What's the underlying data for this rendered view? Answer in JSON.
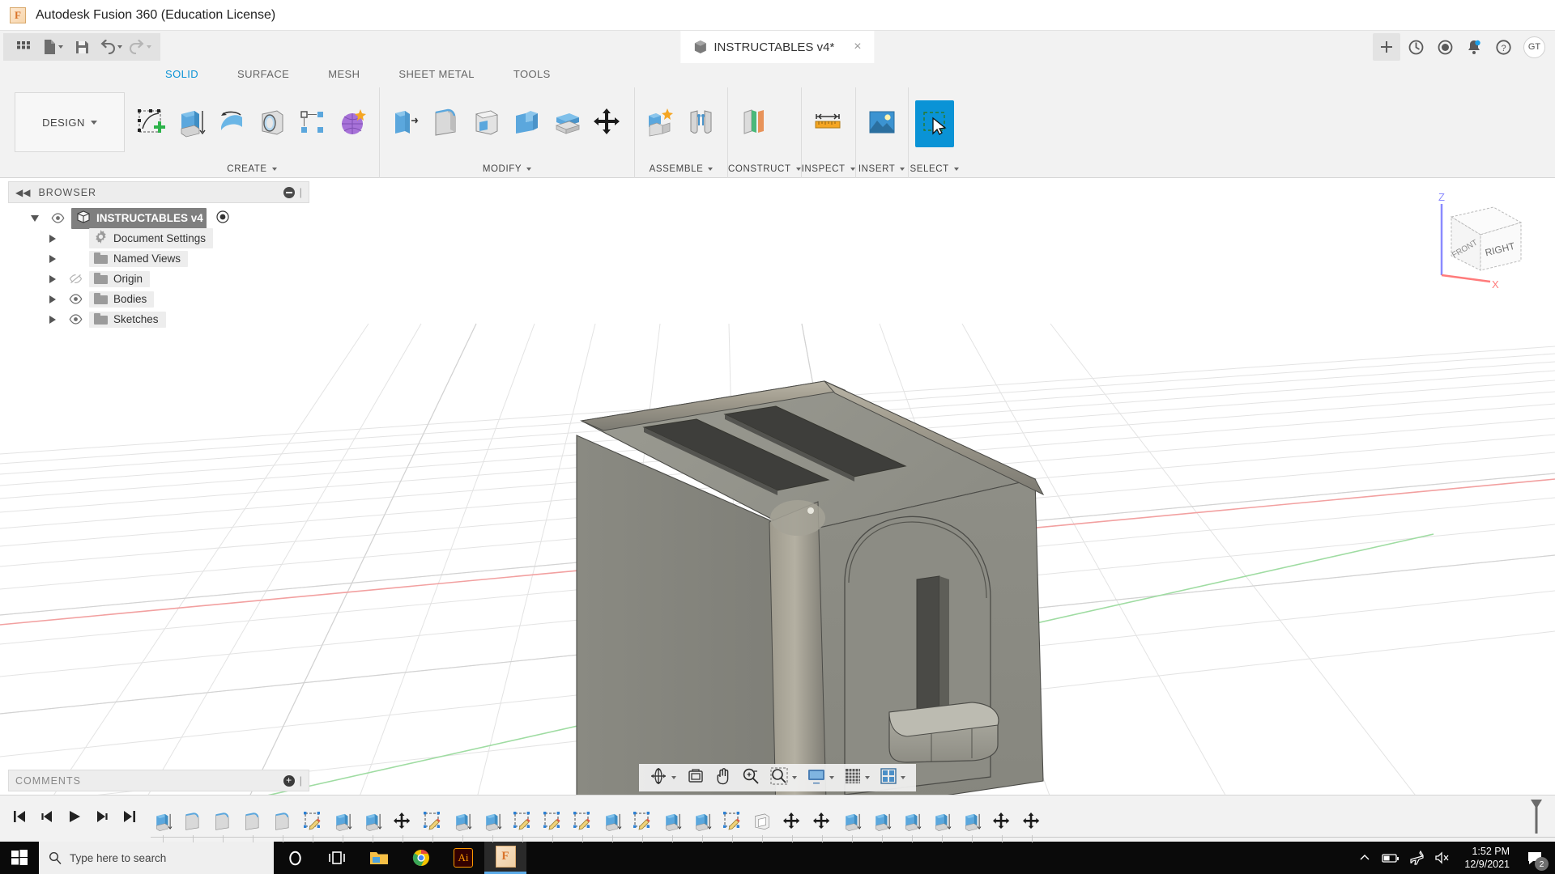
{
  "window": {
    "app_title": "Autodesk Fusion 360 (Education License)",
    "app_icon": "fusion-logo-icon"
  },
  "quick_access": {
    "grid_label": "app-grid",
    "items": [
      {
        "name": "new-document",
        "icon": "file-icon",
        "caret": true
      },
      {
        "name": "save",
        "icon": "save-icon",
        "caret": false
      },
      {
        "name": "undo",
        "icon": "undo-arrow-icon",
        "caret": true
      },
      {
        "name": "redo",
        "icon": "redo-arrow-icon",
        "caret": true
      }
    ]
  },
  "document_tab": {
    "title": "INSTRUCTABLES v4*",
    "icon": "document-cube-icon",
    "close_label": "×",
    "add_label": "+"
  },
  "top_right_icons": [
    {
      "name": "add-tab-button",
      "glyph": "+"
    },
    {
      "name": "job-status-icon",
      "glyph": "circle-arrow"
    },
    {
      "name": "history-clock-icon",
      "glyph": "clock"
    },
    {
      "name": "notifications-bell-icon",
      "glyph": "bell"
    },
    {
      "name": "help-question-icon",
      "glyph": "question"
    }
  ],
  "account": {
    "initials": "GT"
  },
  "ribbon": {
    "workspace_label": "DESIGN",
    "tabs": [
      {
        "label": "SOLID",
        "active": true
      },
      {
        "label": "SURFACE",
        "active": false
      },
      {
        "label": "MESH",
        "active": false
      },
      {
        "label": "SHEET METAL",
        "active": false
      },
      {
        "label": "TOOLS",
        "active": false
      }
    ],
    "groups": [
      {
        "label": "CREATE",
        "has_caret": true,
        "items": [
          {
            "name": "create-sketch-button",
            "icon": "sketch-plus-icon"
          },
          {
            "name": "extrude-button",
            "icon": "extrude-icon"
          },
          {
            "name": "revolve-button",
            "icon": "revolve-icon"
          },
          {
            "name": "hole-button",
            "icon": "hole-icon"
          },
          {
            "name": "pattern-button",
            "icon": "rectangular-pattern-icon"
          },
          {
            "name": "form-button",
            "icon": "form-sculpt-icon"
          }
        ]
      },
      {
        "label": "MODIFY",
        "has_caret": true,
        "items": [
          {
            "name": "press-pull-button",
            "icon": "press-pull-icon"
          },
          {
            "name": "fillet-button",
            "icon": "fillet-icon"
          },
          {
            "name": "shell-button",
            "icon": "shell-icon"
          },
          {
            "name": "combine-button",
            "icon": "combine-icon"
          },
          {
            "name": "offset-face-button",
            "icon": "offset-face-icon"
          },
          {
            "name": "move-copy-button",
            "icon": "move-copy-icon"
          }
        ]
      },
      {
        "label": "ASSEMBLE",
        "has_caret": true,
        "items": [
          {
            "name": "new-component-button",
            "icon": "new-component-icon"
          },
          {
            "name": "joint-button",
            "icon": "joint-icon"
          }
        ]
      },
      {
        "label": "CONSTRUCT",
        "has_caret": true,
        "items": [
          {
            "name": "offset-plane-button",
            "icon": "construction-plane-icon"
          }
        ]
      },
      {
        "label": "INSPECT",
        "has_caret": true,
        "items": [
          {
            "name": "measure-button",
            "icon": "measure-ruler-icon"
          }
        ]
      },
      {
        "label": "INSERT",
        "has_caret": true,
        "items": [
          {
            "name": "insert-canvas-button",
            "icon": "image-canvas-icon"
          }
        ]
      },
      {
        "label": "SELECT",
        "has_caret": true,
        "items": [
          {
            "name": "select-tool-button",
            "icon": "select-cursor-icon",
            "selected": true
          }
        ]
      }
    ]
  },
  "browser": {
    "panel_title": "BROWSER",
    "collapse_icon": "double-chevron-left-icon",
    "tree": [
      {
        "label": "INSTRUCTABLES v4",
        "icon": "component-cube-icon",
        "indent": 0,
        "expanded": true,
        "visible": true,
        "selected": true,
        "has_radio": true
      },
      {
        "label": "Document Settings",
        "icon": "gear-icon",
        "indent": 1,
        "expanded": false,
        "visible": null,
        "selected": false
      },
      {
        "label": "Named Views",
        "icon": "folder-icon",
        "indent": 1,
        "expanded": false,
        "visible": null,
        "selected": false
      },
      {
        "label": "Origin",
        "icon": "folder-icon",
        "indent": 1,
        "expanded": false,
        "visible": false,
        "selected": false
      },
      {
        "label": "Bodies",
        "icon": "folder-icon",
        "indent": 1,
        "expanded": false,
        "visible": true,
        "selected": false
      },
      {
        "label": "Sketches",
        "icon": "folder-icon",
        "indent": 1,
        "expanded": false,
        "visible": true,
        "selected": false
      }
    ]
  },
  "comments": {
    "title": "COMMENTS",
    "add_icon": "plus-circle-icon"
  },
  "viewcube": {
    "front_face": "FRONT",
    "right_face": "RIGHT",
    "axis_z": "Z",
    "axis_x": "X",
    "axis_z_color": "#6a6aff",
    "axis_x_color": "#ff5a5a"
  },
  "navbar": {
    "items": [
      {
        "name": "orbit-button",
        "icon": "orbit-icon",
        "caret": true
      },
      {
        "name": "look-at-button",
        "icon": "look-at-icon",
        "caret": false
      },
      {
        "name": "pan-button",
        "icon": "pan-hand-icon",
        "caret": false
      },
      {
        "name": "zoom-button",
        "icon": "zoom-magnifier-icon",
        "caret": false
      },
      {
        "name": "fit-button",
        "icon": "fit-window-icon",
        "caret": true
      },
      {
        "name": "display-settings-button",
        "icon": "monitor-display-icon",
        "caret": true
      },
      {
        "name": "grid-snaps-button",
        "icon": "grid-icon",
        "caret": true
      },
      {
        "name": "viewports-button",
        "icon": "viewports-icon",
        "caret": true
      }
    ]
  },
  "timeline": {
    "playback": [
      {
        "name": "go-to-beginning-button",
        "icon": "skip-start-icon"
      },
      {
        "name": "step-back-button",
        "icon": "step-back-icon"
      },
      {
        "name": "play-button",
        "icon": "play-icon"
      },
      {
        "name": "step-forward-button",
        "icon": "step-forward-icon"
      },
      {
        "name": "go-to-end-button",
        "icon": "skip-end-icon"
      }
    ],
    "features": [
      {
        "name": "timeline-feature-extrude",
        "icon": "extrude-icon"
      },
      {
        "name": "timeline-feature-fillet",
        "icon": "fillet-icon"
      },
      {
        "name": "timeline-feature-fillet",
        "icon": "fillet-icon"
      },
      {
        "name": "timeline-feature-fillet",
        "icon": "fillet-icon"
      },
      {
        "name": "timeline-feature-fillet",
        "icon": "fillet-icon"
      },
      {
        "name": "timeline-feature-sketch",
        "icon": "sketch-icon"
      },
      {
        "name": "timeline-feature-extrude",
        "icon": "extrude-icon"
      },
      {
        "name": "timeline-feature-extrude",
        "icon": "extrude-icon"
      },
      {
        "name": "timeline-feature-move",
        "icon": "move-icon"
      },
      {
        "name": "timeline-feature-sketch",
        "icon": "sketch-icon"
      },
      {
        "name": "timeline-feature-extrude",
        "icon": "extrude-icon"
      },
      {
        "name": "timeline-feature-extrude",
        "icon": "extrude-icon"
      },
      {
        "name": "timeline-feature-sketch",
        "icon": "sketch-icon"
      },
      {
        "name": "timeline-feature-sketch",
        "icon": "sketch-icon"
      },
      {
        "name": "timeline-feature-sketch",
        "icon": "sketch-icon"
      },
      {
        "name": "timeline-feature-extrude",
        "icon": "extrude-icon"
      },
      {
        "name": "timeline-feature-sketch",
        "icon": "sketch-icon"
      },
      {
        "name": "timeline-feature-extrude",
        "icon": "extrude-icon"
      },
      {
        "name": "timeline-feature-extrude",
        "icon": "extrude-icon"
      },
      {
        "name": "timeline-feature-sketch",
        "icon": "sketch-icon"
      },
      {
        "name": "timeline-feature-shell",
        "icon": "shell-icon"
      },
      {
        "name": "timeline-feature-move",
        "icon": "move-icon"
      },
      {
        "name": "timeline-feature-move",
        "icon": "move-icon"
      },
      {
        "name": "timeline-feature-extrude",
        "icon": "extrude-icon"
      },
      {
        "name": "timeline-feature-extrude",
        "icon": "extrude-icon"
      },
      {
        "name": "timeline-feature-extrude",
        "icon": "extrude-icon"
      },
      {
        "name": "timeline-feature-extrude",
        "icon": "extrude-icon"
      },
      {
        "name": "timeline-feature-extrude",
        "icon": "extrude-icon"
      },
      {
        "name": "timeline-feature-move",
        "icon": "move-icon"
      },
      {
        "name": "timeline-feature-move",
        "icon": "move-icon"
      }
    ],
    "marker": "timeline-end-marker"
  },
  "taskbar": {
    "start_label": "windows-start-icon",
    "search_placeholder": "Type here to search",
    "apps": [
      {
        "name": "cortana-icon",
        "glyph": "cortana"
      },
      {
        "name": "task-view-icon",
        "glyph": "taskview"
      },
      {
        "name": "file-explorer-icon",
        "glyph": "folder"
      },
      {
        "name": "google-chrome-icon",
        "glyph": "chrome"
      },
      {
        "name": "adobe-illustrator-icon",
        "glyph": "Ai"
      },
      {
        "name": "fusion-360-icon",
        "glyph": "F",
        "active": true
      }
    ],
    "tray": [
      {
        "name": "show-hidden-icons-chevron",
        "glyph": "chevron-up"
      },
      {
        "name": "battery-icon",
        "glyph": "battery"
      },
      {
        "name": "airplane-mode-icon",
        "glyph": "airplane"
      },
      {
        "name": "volume-muted-icon",
        "glyph": "speaker-mute"
      }
    ],
    "clock": {
      "time": "1:52 PM",
      "date": "12/9/2021"
    },
    "notifications": {
      "count": "2",
      "icon": "action-center-icon"
    }
  }
}
